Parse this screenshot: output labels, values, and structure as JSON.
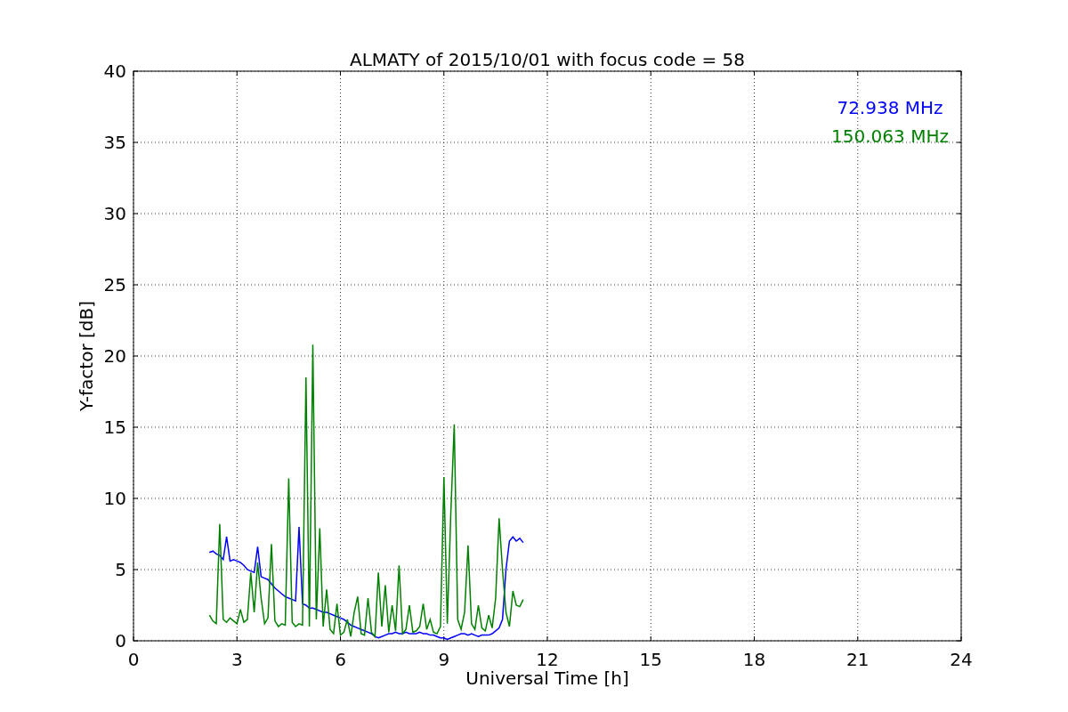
{
  "chart_data": {
    "type": "line",
    "title": "ALMATY of 2015/10/01 with focus code = 58",
    "xlabel": "Universal Time [h]",
    "ylabel": "Y-factor [dB]",
    "x": [
      2.2,
      2.3,
      2.4,
      2.5,
      2.6,
      2.7,
      2.8,
      2.9,
      3.0,
      3.1,
      3.2,
      3.3,
      3.4,
      3.5,
      3.6,
      3.7,
      3.8,
      3.9,
      4.0,
      4.1,
      4.2,
      4.3,
      4.4,
      4.5,
      4.6,
      4.7,
      4.8,
      4.9,
      5.0,
      5.1,
      5.2,
      5.3,
      5.4,
      5.5,
      5.6,
      5.7,
      5.8,
      5.9,
      6.0,
      6.1,
      6.2,
      6.3,
      6.4,
      6.5,
      6.6,
      6.7,
      6.8,
      6.9,
      7.0,
      7.1,
      7.2,
      7.3,
      7.4,
      7.5,
      7.6,
      7.7,
      7.8,
      7.9,
      8.0,
      8.1,
      8.2,
      8.3,
      8.4,
      8.5,
      8.6,
      8.7,
      8.8,
      8.9,
      9.0,
      9.1,
      9.2,
      9.3,
      9.4,
      9.5,
      9.6,
      9.7,
      9.8,
      9.9,
      10.0,
      10.1,
      10.2,
      10.3,
      10.4,
      10.5,
      10.6,
      10.7,
      10.8,
      10.9,
      11.0,
      11.1,
      11.2,
      11.3
    ],
    "series": [
      {
        "name": "72.938 MHz",
        "color": "#0000ff",
        "values": [
          6.2,
          6.3,
          6.1,
          6.0,
          5.7,
          7.3,
          5.6,
          5.7,
          5.6,
          5.5,
          5.3,
          5.0,
          4.9,
          4.8,
          6.6,
          4.5,
          4.4,
          4.3,
          4.0,
          3.7,
          3.5,
          3.3,
          3.1,
          3.0,
          2.9,
          2.8,
          8.0,
          2.6,
          2.5,
          2.3,
          2.3,
          2.2,
          2.1,
          2.0,
          2.0,
          1.9,
          1.8,
          1.7,
          1.6,
          1.5,
          1.3,
          1.1,
          1.0,
          0.9,
          0.8,
          0.7,
          0.6,
          0.5,
          0.3,
          0.2,
          0.3,
          0.4,
          0.5,
          0.5,
          0.6,
          0.5,
          0.5,
          0.6,
          0.5,
          0.5,
          0.5,
          0.6,
          0.5,
          0.5,
          0.4,
          0.4,
          0.3,
          0.2,
          0.2,
          0.1,
          0.2,
          0.3,
          0.4,
          0.5,
          0.5,
          0.4,
          0.5,
          0.4,
          0.3,
          0.4,
          0.4,
          0.4,
          0.5,
          0.7,
          0.9,
          1.5,
          5.0,
          7.0,
          7.3,
          7.0,
          7.2,
          6.9
        ]
      },
      {
        "name": "150.063 MHz",
        "color": "#008000",
        "values": [
          1.8,
          1.4,
          1.2,
          8.2,
          1.5,
          1.3,
          1.6,
          1.4,
          1.2,
          2.2,
          1.3,
          1.5,
          4.8,
          2.0,
          5.5,
          3.0,
          1.2,
          1.6,
          6.8,
          1.4,
          1.0,
          1.2,
          1.1,
          11.4,
          1.3,
          1.0,
          1.2,
          1.1,
          18.5,
          1.0,
          20.8,
          1.5,
          7.9,
          1.0,
          3.6,
          0.8,
          0.5,
          2.6,
          0.4,
          0.6,
          1.5,
          0.3,
          2.0,
          3.1,
          0.5,
          0.4,
          3.0,
          0.6,
          0.3,
          4.8,
          1.0,
          3.9,
          0.6,
          2.5,
          0.7,
          5.3,
          0.5,
          0.8,
          2.5,
          0.6,
          0.7,
          1.0,
          2.6,
          0.8,
          1.5,
          0.6,
          0.5,
          1.0,
          11.5,
          1.2,
          8.9,
          15.2,
          1.5,
          0.8,
          2.0,
          6.7,
          1.2,
          0.8,
          2.5,
          0.9,
          0.7,
          1.8,
          0.9,
          3.0,
          8.6,
          5.0,
          2.0,
          1.0,
          3.5,
          2.5,
          2.4,
          2.9
        ]
      }
    ],
    "grid": true,
    "xlim": [
      0,
      24
    ],
    "ylim": [
      0,
      40
    ],
    "xticks": [
      0,
      3,
      6,
      9,
      12,
      15,
      18,
      21,
      24
    ],
    "yticks": [
      0,
      5,
      10,
      15,
      20,
      25,
      30,
      35,
      40
    ]
  }
}
